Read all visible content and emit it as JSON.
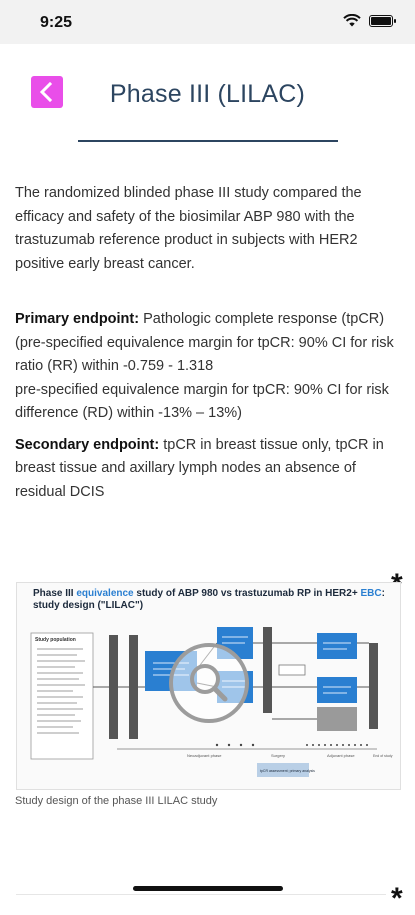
{
  "status": {
    "time": "9:25"
  },
  "header": {
    "title": "Phase III (LILAC)"
  },
  "intro": "The randomized blinded phase III study compared the efficacy and safety of the biosimilar ABP 980 with the trastuzumab reference product in subjects with HER2 positive early breast cancer.",
  "primary": {
    "label": "Primary endpoint:",
    "text": " Pathologic complete response (tpCR)",
    "line2": "(pre-specified equivalence margin for tpCR: 90% CI for risk ratio (RR) within -0.759 - 1.318",
    "line3": "pre-specified equivalence margin for tpCR: 90% CI for risk difference (RD) within -13% – 13%)"
  },
  "secondary": {
    "label": "Secondary endpoint:",
    "text": " tpCR in breast tissue only, tpCR in breast tissue and axillary lymph nodes an absence of residual DCIS"
  },
  "figure": {
    "title_prefix": "Phase III ",
    "title_highlight": "equivalence",
    "title_mid": " study of ABP 980 vs trastuzumab RP in HER2+ ",
    "title_highlight2": "EBC",
    "title_suffix": ": study design (\"LILAC\")",
    "caption": "Study design of the phase III LILAC study",
    "study_population_label": "Study population",
    "neoadjuvant_label": "Neoadjuvant phase",
    "surgery_label": "Surgery",
    "adjuvant_label": "Adjuvant phase",
    "end_label": "End of study",
    "endpoint_box_label": "tpCR assessment; primary analysis"
  },
  "markers": {
    "asterisk": "*"
  },
  "colors": {
    "accent": "#e94ee9",
    "title": "#2c4560",
    "fig_blue": "#2a7fd1"
  }
}
